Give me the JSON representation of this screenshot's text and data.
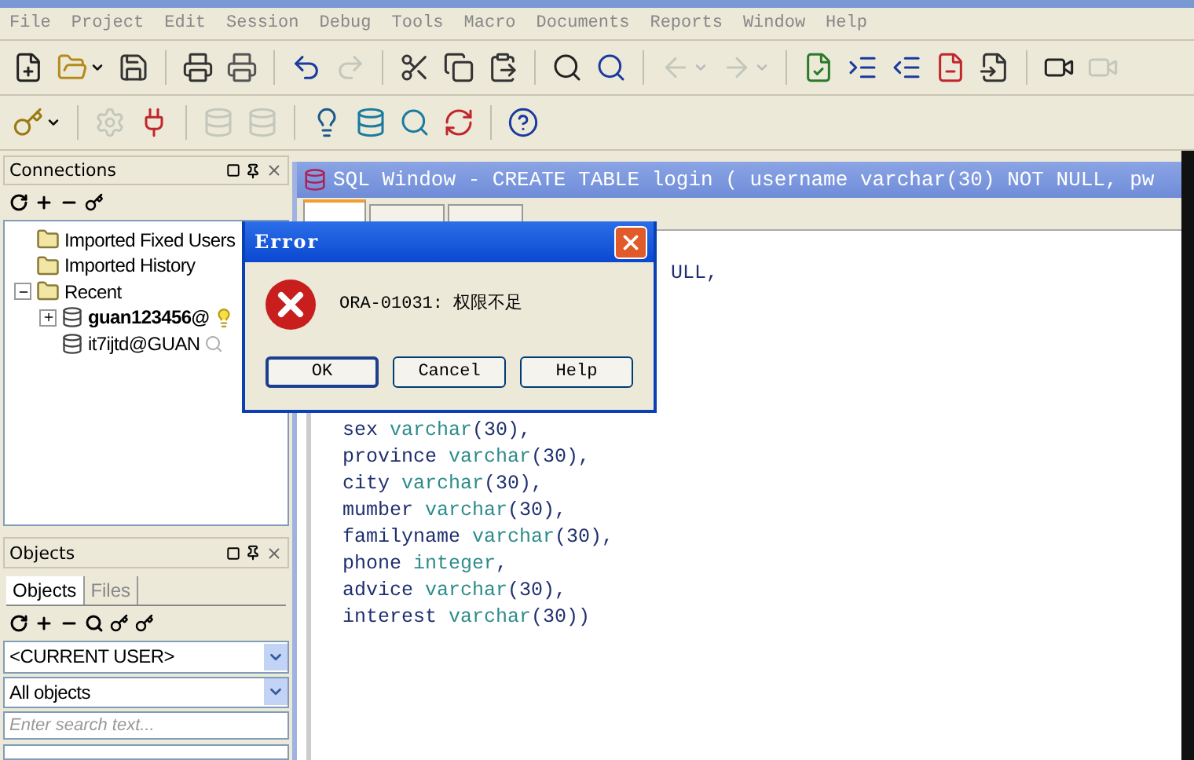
{
  "menu": [
    "File",
    "Project",
    "Edit",
    "Session",
    "Debug",
    "Tools",
    "Macro",
    "Documents",
    "Reports",
    "Window",
    "Help"
  ],
  "toolbar_1": [
    {
      "kind": "new",
      "disabled": false
    },
    {
      "kind": "open",
      "disabled": false,
      "dropdown": true
    },
    {
      "kind": "save",
      "disabled": false
    },
    {
      "kind": "sep"
    },
    {
      "kind": "print",
      "disabled": false
    },
    {
      "kind": "printer2",
      "disabled": false
    },
    {
      "kind": "sep"
    },
    {
      "kind": "undo",
      "disabled": false
    },
    {
      "kind": "redo",
      "disabled": true
    },
    {
      "kind": "sep"
    },
    {
      "kind": "cut",
      "disabled": false
    },
    {
      "kind": "copy",
      "disabled": false
    },
    {
      "kind": "paste",
      "disabled": false
    },
    {
      "kind": "sep"
    },
    {
      "kind": "find",
      "disabled": false
    },
    {
      "kind": "findnext",
      "disabled": false
    },
    {
      "kind": "sep"
    },
    {
      "kind": "back",
      "disabled": true,
      "dropdown": true
    },
    {
      "kind": "forward",
      "disabled": true,
      "dropdown": true
    },
    {
      "kind": "sep"
    },
    {
      "kind": "check",
      "disabled": false
    },
    {
      "kind": "indent",
      "disabled": false
    },
    {
      "kind": "unindent",
      "disabled": false
    },
    {
      "kind": "docred",
      "disabled": false
    },
    {
      "kind": "docin",
      "disabled": false
    },
    {
      "kind": "sep"
    },
    {
      "kind": "camera",
      "disabled": false
    },
    {
      "kind": "camera",
      "disabled": true
    }
  ],
  "toolbar_2": [
    {
      "kind": "key",
      "disabled": false,
      "dropdown": true
    },
    {
      "kind": "sep"
    },
    {
      "kind": "gear",
      "disabled": true
    },
    {
      "kind": "plug",
      "disabled": false
    },
    {
      "kind": "sep"
    },
    {
      "kind": "dbdown",
      "disabled": true
    },
    {
      "kind": "dbup",
      "disabled": true
    },
    {
      "kind": "sep"
    },
    {
      "kind": "dbbulb",
      "disabled": false
    },
    {
      "kind": "dbsql",
      "disabled": false
    },
    {
      "kind": "dbfind",
      "disabled": false
    },
    {
      "kind": "dbrefresh",
      "disabled": false
    },
    {
      "kind": "sep"
    },
    {
      "kind": "help",
      "disabled": false
    }
  ],
  "connections": {
    "title": "Connections",
    "tree": [
      {
        "label": "Imported Fixed Users"
      },
      {
        "label": "Imported History"
      },
      {
        "label": "Recent",
        "expanded": true,
        "children": [
          {
            "label": "guan123456@",
            "expanded": false,
            "current": true
          },
          {
            "label": "it7ijtd@GUAN",
            "current": false
          }
        ]
      }
    ]
  },
  "objects": {
    "title": "Objects",
    "tabs": [
      {
        "label": "Objects",
        "selected": true
      },
      {
        "label": "Files",
        "selected": false
      }
    ],
    "user_select": "<CURRENT USER>",
    "type_select": "All objects",
    "search": {
      "placeholder": "Enter search text..."
    }
  },
  "sql_window": {
    "title": "SQL Window - CREATE TABLE login ( username varchar(30) NOT NULL, pw",
    "tabs": [
      {
        "selected": true
      },
      {
        "selected": false
      },
      {
        "selected": false
      }
    ],
    "fragment": "ULL,",
    "lines": [
      {
        "name": "sex",
        "type": "varchar",
        "rest": "(30),"
      },
      {
        "name": "province",
        "type": "varchar",
        "rest": "(30),"
      },
      {
        "name": "city",
        "type": "varchar",
        "rest": "(30),"
      },
      {
        "name": "mumber",
        "type": "varchar",
        "rest": "(30),"
      },
      {
        "name": "familyname",
        "type": "varchar",
        "rest": "(30),"
      },
      {
        "name": "phone",
        "type": "integer",
        "rest": ","
      },
      {
        "name": "advice",
        "type": "varchar",
        "rest": "(30),"
      },
      {
        "name": "interest",
        "type": "varchar",
        "rest": "(30))"
      }
    ]
  },
  "dialog": {
    "title": "Error",
    "message": "ORA-01031: 权限不足",
    "buttons": [
      {
        "label": "OK",
        "default": true
      },
      {
        "label": "Cancel",
        "default": false
      },
      {
        "label": "Help",
        "default": false
      }
    ]
  }
}
